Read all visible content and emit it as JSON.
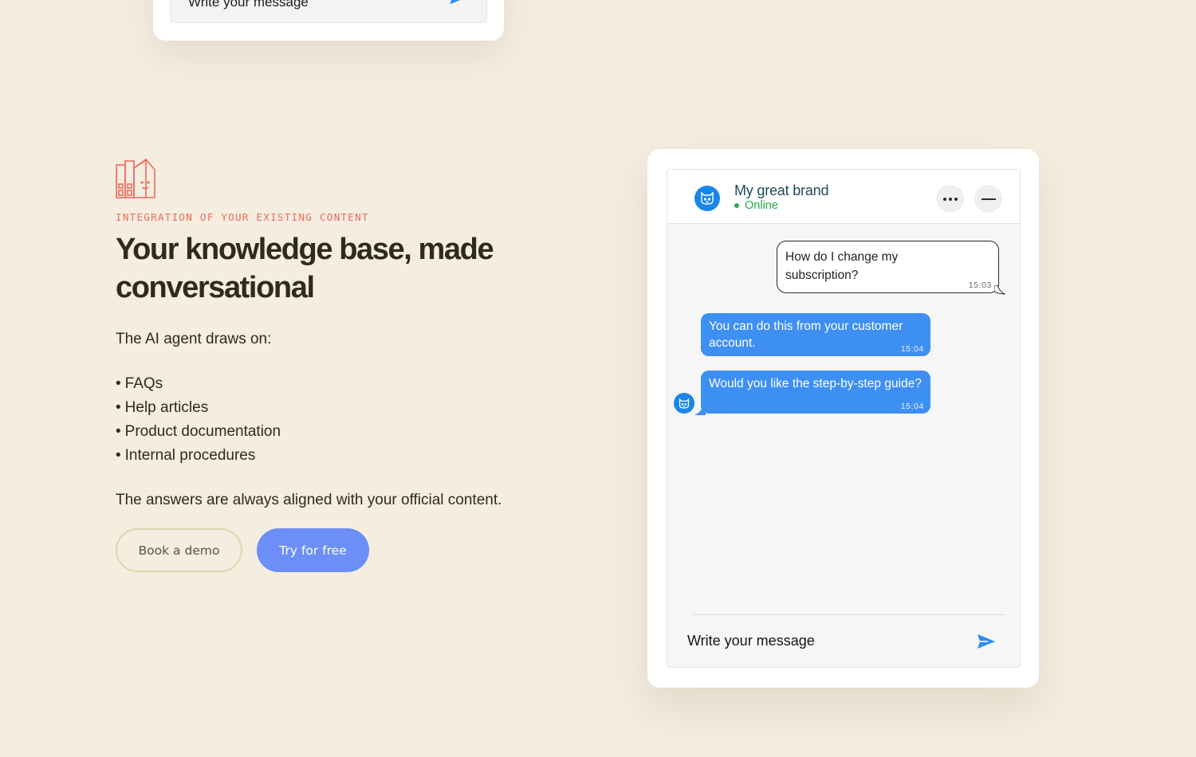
{
  "top_widget": {
    "input_placeholder": "Write your message"
  },
  "feature": {
    "icon": "library-books-icon",
    "eyebrow": "INTEGRATION OF YOUR EXISTING CONTENT",
    "headline": "Your knowledge base, made conversational",
    "intro": "The AI agent draws on:",
    "bullets": [
      "FAQs",
      "Help articles",
      "Product documentation",
      "Internal procedures"
    ],
    "closing": "The answers are always aligned with your official content.",
    "buttons": {
      "book_demo": "Book a demo",
      "try_free": "Try for free"
    }
  },
  "chat": {
    "brand_name": "My great brand",
    "status": "Online",
    "messages": [
      {
        "from": "user",
        "text": "How do I change my subscription?",
        "time": "15:03"
      },
      {
        "from": "bot",
        "text": "You can do this from your customer account.",
        "time": "15:04"
      },
      {
        "from": "bot",
        "text": "Would you like the step-by-step guide?",
        "time": "15:04"
      }
    ],
    "composer_placeholder": "Write your message"
  },
  "colors": {
    "background": "#f4ede0",
    "accent_coral": "#ee6a5a",
    "primary_button": "#6b8ff7",
    "bot_bubble": "#3d8ff2",
    "online_green": "#2aa84a"
  }
}
